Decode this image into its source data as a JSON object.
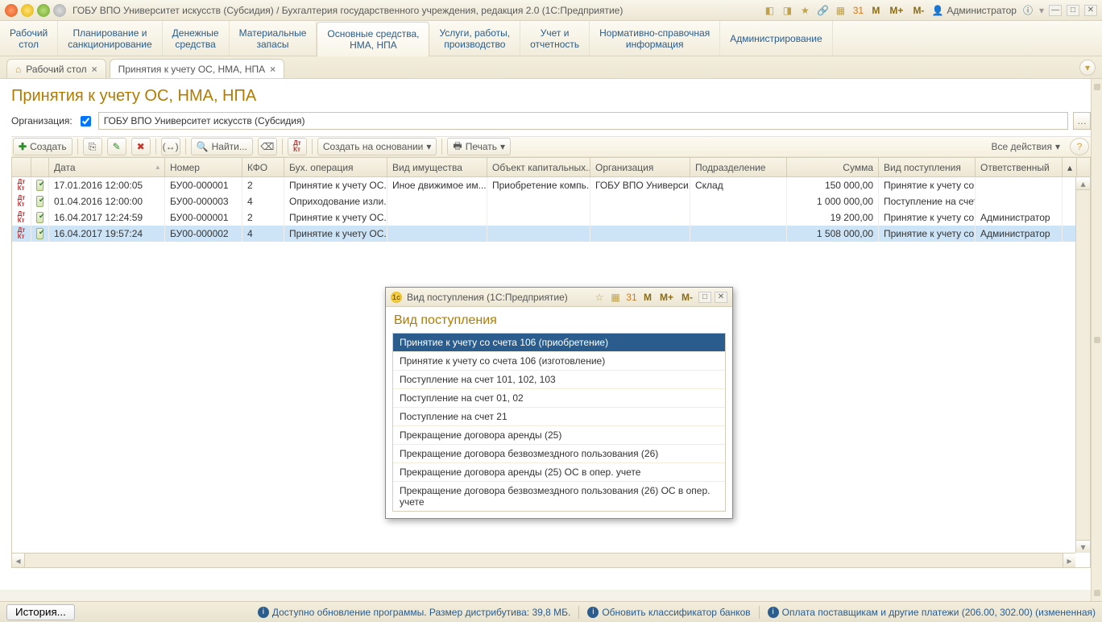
{
  "titlebar": {
    "title": "ГОБУ ВПО Университет искусств (Субсидия) / Бухгалтерия государственного учреждения, редакция 2.0  (1С:Предприятие)",
    "m": "M",
    "mplus": "M+",
    "mminus": "M-",
    "user": "Администратор"
  },
  "nav": [
    {
      "l1": "Рабочий",
      "l2": "стол"
    },
    {
      "l1": "Планирование и",
      "l2": "санкционирование"
    },
    {
      "l1": "Денежные",
      "l2": "средства"
    },
    {
      "l1": "Материальные",
      "l2": "запасы"
    },
    {
      "l1": "Основные средства,",
      "l2": "НМА, НПА",
      "active": true
    },
    {
      "l1": "Услуги, работы,",
      "l2": "производство"
    },
    {
      "l1": "Учет и",
      "l2": "отчетность"
    },
    {
      "l1": "Нормативно-справочная",
      "l2": "информация"
    },
    {
      "l1": "Администрирование",
      "l2": ""
    }
  ],
  "tabs": {
    "t1": "Рабочий стол",
    "t2": "Принятия к учету ОС, НМА, НПА"
  },
  "page": {
    "title": "Принятия к учету ОС, НМА, НПА",
    "org_label": "Организация:",
    "org_value": "ГОБУ ВПО Университет искусств (Субсидия)"
  },
  "toolbar": {
    "create": "Создать",
    "find": "Найти...",
    "create_based": "Создать на основании",
    "print": "Печать",
    "all_actions": "Все действия"
  },
  "columns": {
    "date": "Дата",
    "number": "Номер",
    "kfo": "КФО",
    "op": "Бух. операция",
    "asset": "Вид имущества",
    "obj": "Объект капитальных...",
    "org": "Организация",
    "dept": "Подразделение",
    "sum": "Сумма",
    "entry": "Вид поступления",
    "resp": "Ответственный"
  },
  "rows": [
    {
      "date": "17.01.2016 12:00:05",
      "number": "БУ00-000001",
      "kfo": "2",
      "op": "Принятие к учету ОС...",
      "asset": "Иное движимое им...",
      "obj": "Приобретение компь...",
      "org": "ГОБУ ВПО Универси...",
      "dept": "Склад",
      "sum": "150 000,00",
      "entry": "Принятие к учету со ...",
      "resp": ""
    },
    {
      "date": "01.04.2016 12:00:00",
      "number": "БУ00-000003",
      "kfo": "4",
      "op": "Оприходование изли...",
      "asset": "",
      "obj": "",
      "org": "",
      "dept": "",
      "sum": "1 000 000,00",
      "entry": "Поступление на счет...",
      "resp": ""
    },
    {
      "date": "16.04.2017 12:24:59",
      "number": "БУ00-000001",
      "kfo": "2",
      "op": "Принятие к учету ОС...",
      "asset": "",
      "obj": "",
      "org": "",
      "dept": "",
      "sum": "19 200,00",
      "entry": "Принятие к учету со ...",
      "resp": "Администратор"
    },
    {
      "date": "16.04.2017 19:57:24",
      "number": "БУ00-000002",
      "kfo": "4",
      "op": "Принятие к учету ОС...",
      "asset": "",
      "obj": "",
      "org": "",
      "dept": "",
      "sum": "1 508 000,00",
      "entry": "Принятие к учету со ...",
      "resp": "Администратор",
      "sel": true
    }
  ],
  "modal": {
    "wintitle": "Вид поступления  (1С:Предприятие)",
    "heading": "Вид поступления",
    "m": "M",
    "mplus": "M+",
    "mminus": "M-",
    "items": [
      "Принятие к учету со счета 106 (приобретение)",
      "Принятие к учету со счета 106 (изготовление)",
      "Поступление на счет 101, 102, 103",
      "Поступление на счет 01, 02",
      "Поступление на счет 21",
      "Прекращение договора аренды (25)",
      "Прекращение договора безвозмездного пользования (26)",
      "Прекращение договора аренды (25) ОС в опер. учете",
      "Прекращение договора безвозмездного пользования (26) ОС в опер. учете"
    ],
    "sel": 0
  },
  "status": {
    "history": "История...",
    "upd1": "Доступно обновление программы. Размер дистрибутива: 39,8 МБ.",
    "upd2": "Обновить классификатор банков",
    "upd3": "Оплата поставщикам и другие платежи (206.00, 302.00) (измененная)"
  }
}
